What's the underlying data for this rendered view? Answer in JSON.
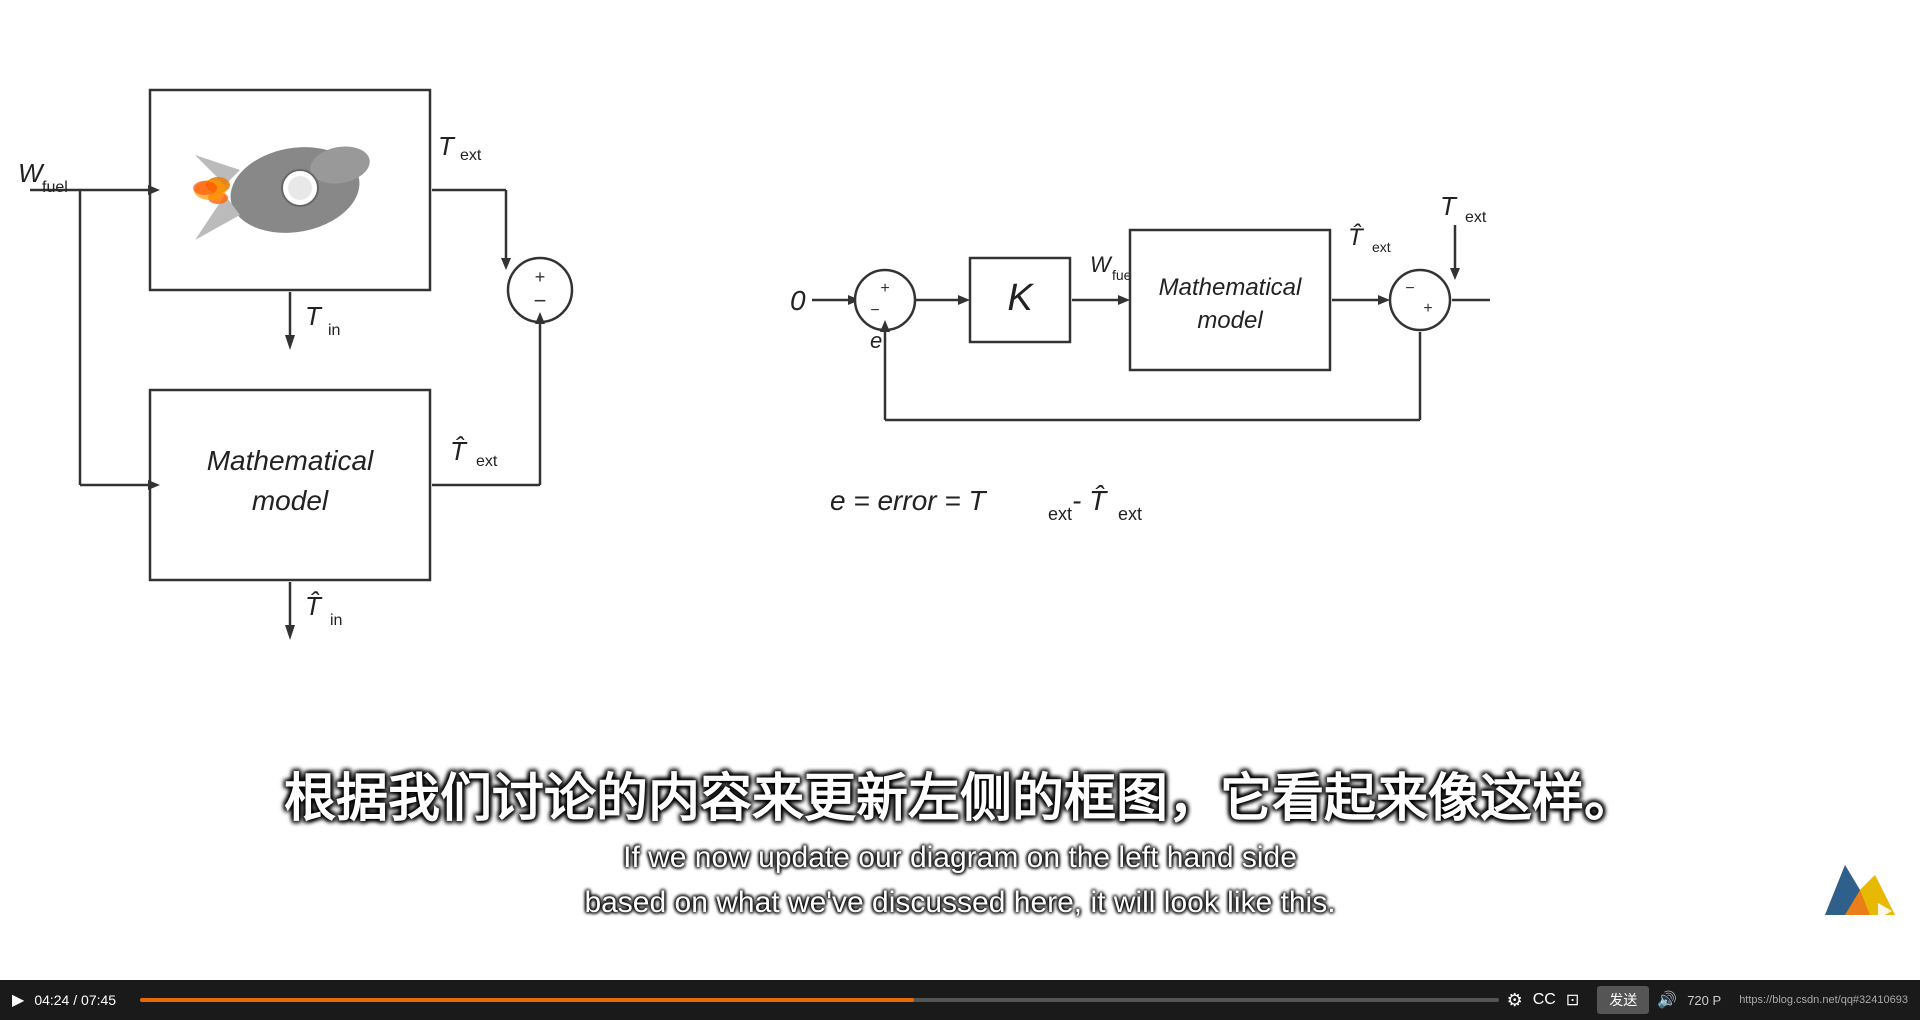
{
  "video": {
    "background_color": "#ffffff",
    "diagram_bg": "#f5f5f5"
  },
  "left_diagram": {
    "w_fuel_label": "W",
    "w_fuel_sub": "fuel",
    "t_ext_label": "T",
    "t_ext_sub": "ext",
    "t_in_label": "T",
    "t_in_sub": "in",
    "t_hat_ext_label": "T̂",
    "t_hat_ext_sub": "ext",
    "t_hat_in_label": "T̂",
    "t_hat_in_sub": "in",
    "sum_symbols": "+ −",
    "math_model_line1": "Mathematical",
    "math_model_line2": "model"
  },
  "right_diagram": {
    "zero_label": "0",
    "e_label": "e",
    "K_label": "K",
    "w_fuel_label": "W",
    "w_fuel_sub": "fuel",
    "math_model_line1": "Mathematical",
    "math_model_line2": "model",
    "t_hat_ext_label": "T̂",
    "t_hat_ext_sub": "ext",
    "t_ext_label": "T",
    "t_ext_sub": "ext",
    "sum1_symbols": "+ −",
    "sum2_symbols": "− +",
    "error_eq": "e = error = T",
    "error_eq_sub": "ext",
    "error_eq2": " - T̂",
    "error_eq2_sub": "ext"
  },
  "subtitle": {
    "chinese": "根据我们讨论的内容来更新左侧的框图，它看起来像这样。",
    "english_line1": "If we now update our diagram on the left hand side",
    "english_line2": "based on what we've discussed here, it will look like this."
  },
  "controls": {
    "time_current": "04:24",
    "time_total": "07:45",
    "resolution": "720",
    "url": "https://blog.csdn.net/qq#32410693",
    "send_btn": "发送"
  }
}
